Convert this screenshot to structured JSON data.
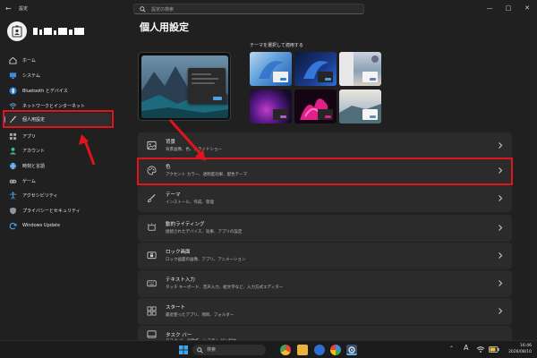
{
  "window": {
    "app_title": "設定",
    "search_placeholder": "設定の検索"
  },
  "sidebar": {
    "items": [
      {
        "label": "ホーム",
        "icon": "home-icon"
      },
      {
        "label": "システム",
        "icon": "system-monitor-icon"
      },
      {
        "label": "Bluetooth とデバイス",
        "icon": "bluetooth-icon"
      },
      {
        "label": "ネットワークとインターネット",
        "icon": "wifi-icon"
      },
      {
        "label": "個人用設定",
        "icon": "paintbrush-icon",
        "active": true
      },
      {
        "label": "アプリ",
        "icon": "apps-icon"
      },
      {
        "label": "アカウント",
        "icon": "account-icon"
      },
      {
        "label": "時刻と言語",
        "icon": "globe-clock-icon"
      },
      {
        "label": "ゲーム",
        "icon": "gamepad-icon"
      },
      {
        "label": "アクセシビリティ",
        "icon": "accessibility-icon"
      },
      {
        "label": "プライバシーとセキュリティ",
        "icon": "shield-icon"
      },
      {
        "label": "Windows Update",
        "icon": "update-icon"
      }
    ]
  },
  "main": {
    "title": "個人用設定",
    "themes_label": "テーマを選択して適用する",
    "cards": [
      {
        "title": "背景",
        "subtitle": "背景画像、色、スライドショー",
        "icon": "image-icon"
      },
      {
        "title": "色",
        "subtitle": "アクセント カラー、透明度効果、配色テーマ",
        "icon": "palette-icon"
      },
      {
        "title": "テーマ",
        "subtitle": "インストール、作成、管理",
        "icon": "theme-brush-icon"
      },
      {
        "title": "動的ライティング",
        "subtitle": "接続されたデバイス、効果、アプリの設定",
        "icon": "lighting-icon"
      },
      {
        "title": "ロック画面",
        "subtitle": "ロック画面の画像、アプリ、アニメーション",
        "icon": "lock-screen-icon"
      },
      {
        "title": "テキスト入力",
        "subtitle": "タッチ キーボード、音声入力、絵文字など、入力方式エディター",
        "icon": "keyboard-icon"
      },
      {
        "title": "スタート",
        "subtitle": "最近使ったアプリ、項目、フォルダー",
        "icon": "start-icon"
      },
      {
        "title": "タスク バー",
        "subtitle": "タスク バーの動作、システム ピン留め",
        "icon": "taskbar-icon"
      }
    ]
  },
  "taskbar": {
    "search_placeholder": "検索",
    "time": "16:46",
    "date": "2026/08/10",
    "ime": "A"
  },
  "colors": {
    "annotation": "#e0141b",
    "accent": "#5ab0f0"
  }
}
